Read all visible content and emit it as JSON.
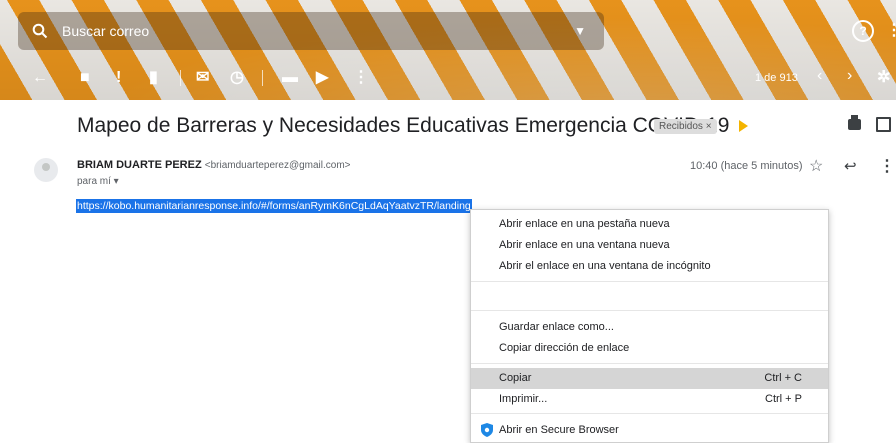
{
  "search": {
    "placeholder": "Buscar correo"
  },
  "header_icons": {
    "help": "?",
    "apps": "⋮"
  },
  "toolbar": {
    "back": "←",
    "archive": "■",
    "report": "!",
    "delete": "▮",
    "mark": "✉",
    "snooze": "◷",
    "move": "▬",
    "label": "▶",
    "more": "⋮",
    "pager": "1 de 913",
    "prev": "‹",
    "next": "›",
    "settings": "✲"
  },
  "email": {
    "subject": "Mapeo de Barreras y Necesidades Educativas Emergencia COVID-19",
    "label_chip": "Recibidos ×",
    "sender_name": "BRIAM DUARTE PEREZ",
    "sender_email": "<briamduarteperez@gmail.com>",
    "to": "para mí ▾",
    "time": "10:40 (hace 5 minutos)",
    "star": "☆",
    "reply": "↩",
    "more": "⋮",
    "link": "https://kobo.humanitarianresponse.info/#/forms/anRymK6nCgLdAqYaatvzTR/landing"
  },
  "context_menu": {
    "items": [
      {
        "label": "Abrir enlace en una pestaña nueva",
        "shortcut": ""
      },
      {
        "label": "Abrir enlace en una ventana nueva",
        "shortcut": ""
      },
      {
        "label": "Abrir el enlace en una ventana de incógnito",
        "shortcut": ""
      },
      {
        "label": "Guardar enlace como...",
        "shortcut": ""
      },
      {
        "label": "Copiar dirección de enlace",
        "shortcut": ""
      },
      {
        "label": "Copiar",
        "shortcut": "Ctrl + C"
      },
      {
        "label": "Imprimir...",
        "shortcut": "Ctrl + P"
      },
      {
        "label": "Abrir en Secure Browser",
        "shortcut": ""
      }
    ]
  },
  "colors": {
    "accent": "#1a73e8",
    "stripe_orange": "#f39a1d",
    "shield": "#1e88e5"
  }
}
